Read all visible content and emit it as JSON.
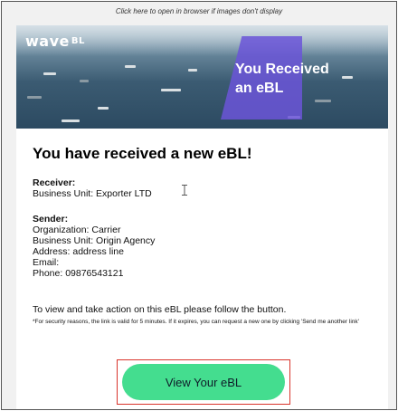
{
  "top_link": "Click here to open in browser if images don't display",
  "banner": {
    "logo": "wave",
    "logo_suffix": "BL",
    "title_line1": "You Received",
    "title_line2": "an eBL"
  },
  "headline": "You have received a new eBL!",
  "receiver": {
    "label": "Receiver:",
    "business_unit": "Business Unit: Exporter LTD"
  },
  "sender": {
    "label": "Sender:",
    "organization": "Organization: Carrier",
    "business_unit": "Business Unit: Origin Agency",
    "address": "Address: address line",
    "email": "Email:",
    "phone": "Phone: 09876543121"
  },
  "instructions": "To view and take action on this eBL please follow the button.",
  "security_note": "*For security reasons, the link is valid for 5 minutes. If it expires, you can request a new one by clicking 'Send me another link'",
  "button": {
    "label": "View Your eBL",
    "color": "#44dd8f"
  },
  "colors": {
    "highlight": "#d9342b",
    "banner_accent": "#6b55d8"
  }
}
